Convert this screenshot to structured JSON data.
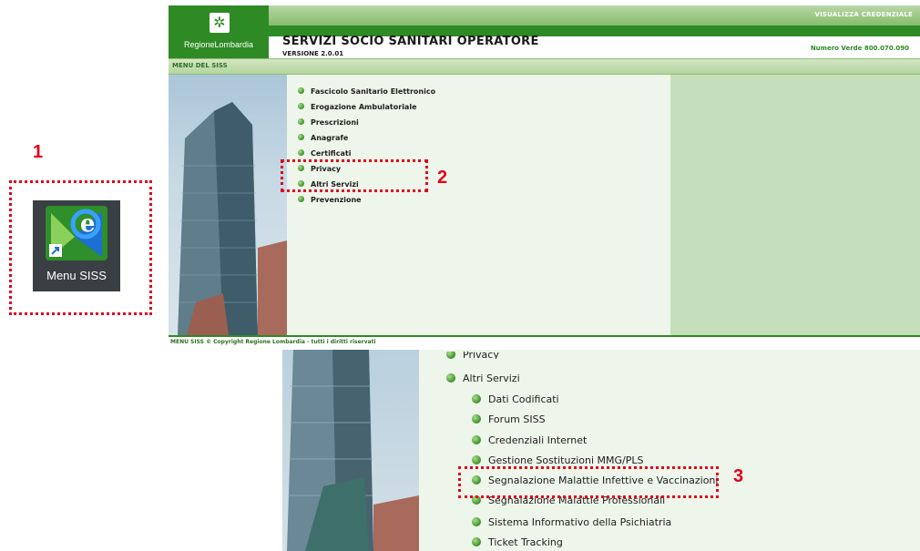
{
  "steps": {
    "one": "1",
    "two": "2",
    "three": "3"
  },
  "desktop_icon": {
    "label": "Menu SISS"
  },
  "window": {
    "top_link": "VISUALIZZA CREDENZIALE",
    "logo_text": "RegioneLombardia",
    "title": "SERVIZI SOCIO SANITARI OPERATORE",
    "version": "VERSIONE 2.0.01",
    "toll_free": "Numero Verde 800.070.090",
    "menu_header": "MENU DEL SISS",
    "menu_items": [
      "Fascicolo Sanitario Elettronico",
      "Erogazione Ambulatoriale",
      "Prescrizioni",
      "Anagrafe",
      "Certificati",
      "Privacy",
      "Altri Servizi",
      "Prevenzione"
    ],
    "footer": "MENU SISS © Copyright Regione Lombardia - tutti i diritti riservati"
  },
  "submenu": {
    "cut_item": "Privacy",
    "parent": "Altri Servizi",
    "items": [
      "Dati Codificati",
      "Forum SISS",
      "Credenziali Internet",
      "Gestione Sostituzioni MMG/PLS",
      "Segnalazione Malattie Infettive e Vaccinazioni",
      "Segnalazione Malattie Professionali",
      "Sistema Informativo della Psichiatria",
      "Ticket Tracking"
    ]
  },
  "colors": {
    "brand_green": "#2e8a24",
    "highlight_red": "#e0001b",
    "menu_bg": "#eef5ea",
    "side_bg": "#c5dfba"
  }
}
